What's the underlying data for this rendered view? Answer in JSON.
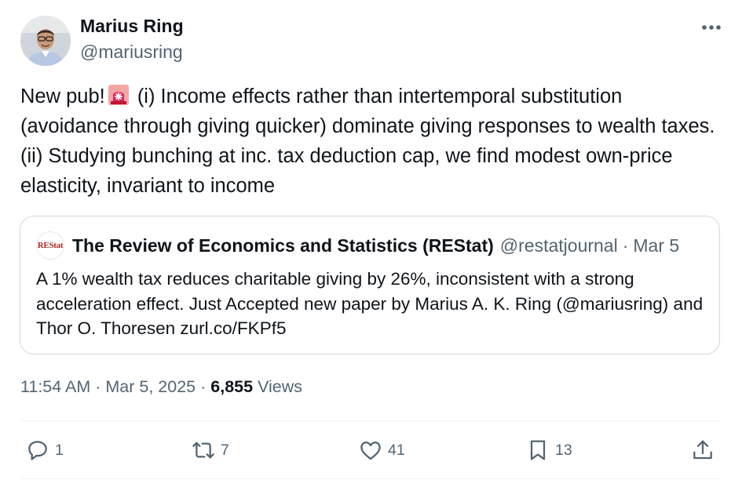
{
  "author": {
    "display_name": "Marius Ring",
    "handle": "@mariusring"
  },
  "tweet": {
    "text_before_emoji": "New pub!",
    "emoji": "siren-emoji",
    "text_after_emoji": " (i) Income effects rather than intertemporal substitution (avoidance through giving quicker) dominate giving responses to wealth taxes. (ii) Studying bunching at inc. tax deduction cap, we find modest own-price elasticity, invariant to income"
  },
  "quote": {
    "avatar_text": "REStat",
    "display_name": "The Review of Economics and Statistics (REStat)",
    "handle": "@restatjournal",
    "separator": "·",
    "date": "Mar 5",
    "text": "A 1% wealth tax reduces charitable giving by 26%, inconsistent with a strong acceleration effect. Just Accepted new paper by Marius A. K. Ring (@mariusring) and Thor O. Thoresen zurl.co/FKPf5"
  },
  "meta": {
    "time": "11:54 AM",
    "separator": "·",
    "date": "Mar 5, 2025",
    "views_count": "6,855",
    "views_label": "Views"
  },
  "actions": {
    "reply_count": "1",
    "retweet_count": "7",
    "like_count": "41",
    "bookmark_count": "13"
  },
  "icons": [
    "more-icon",
    "reply-icon",
    "retweet-icon",
    "like-icon",
    "bookmark-icon",
    "share-icon"
  ],
  "colors": {
    "text": "#0f1419",
    "secondary": "#536471",
    "border": "#cfd9de",
    "restat_red": "#b0281f",
    "siren_red": "#e0245e"
  }
}
